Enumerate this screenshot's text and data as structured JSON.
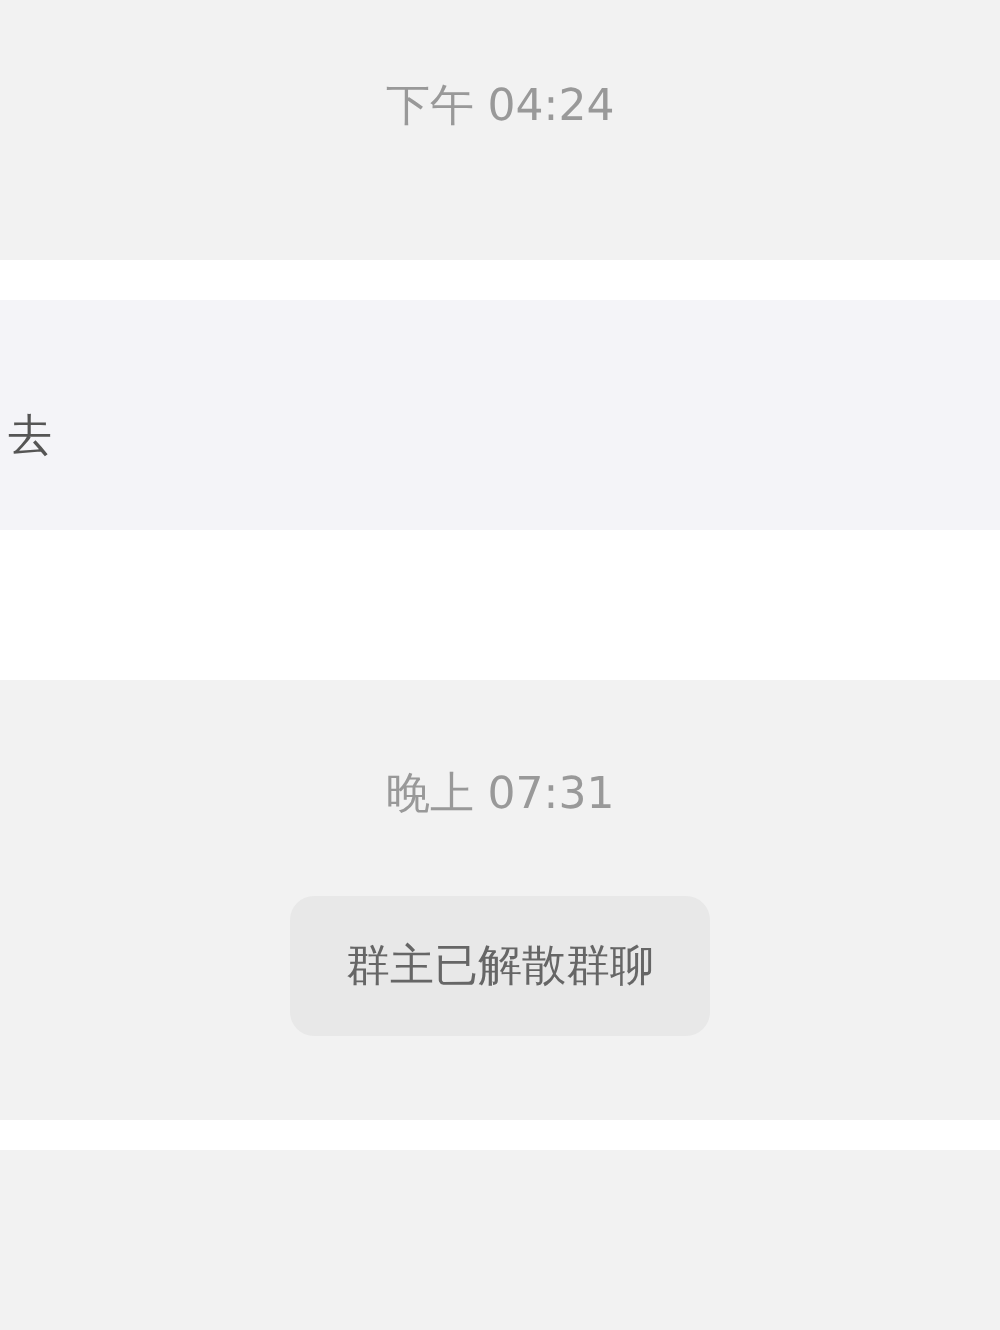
{
  "messages": [
    {
      "kind": "time",
      "text": "下午 04:24"
    },
    {
      "kind": "bubble",
      "text": "去"
    },
    {
      "kind": "time",
      "text": "晚上 07:31"
    },
    {
      "kind": "notice",
      "text": "群主已解散群聊"
    }
  ]
}
